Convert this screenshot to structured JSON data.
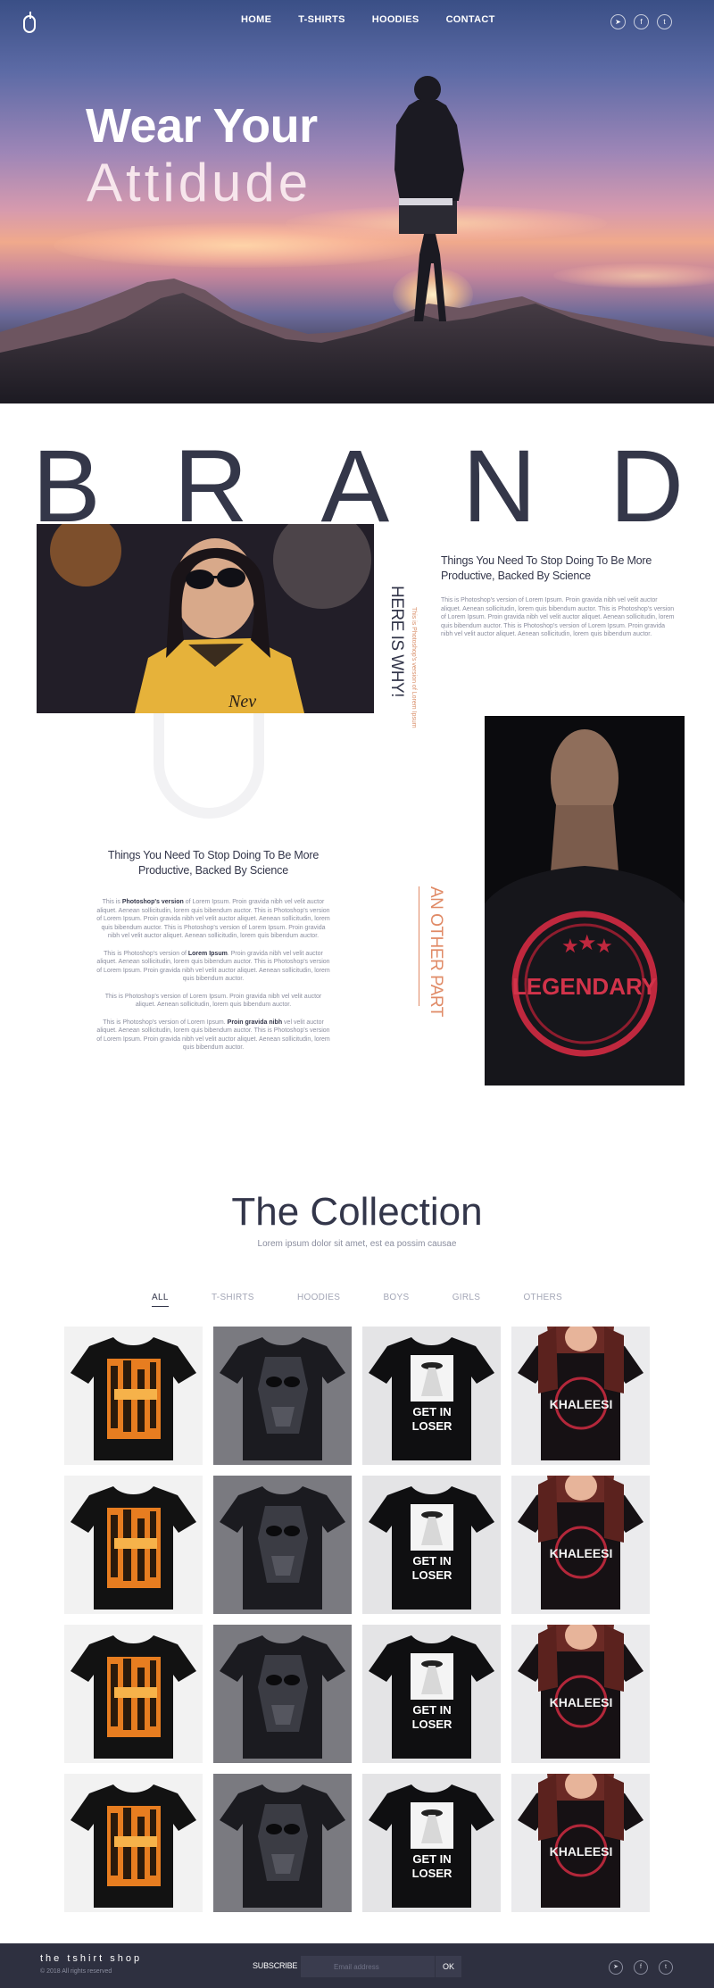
{
  "header": {
    "nav": [
      "HOME",
      "T-SHIRTS",
      "HOODIES",
      "CONTACT"
    ],
    "social_icons": [
      "telegram-icon",
      "facebook-icon",
      "twitter-icon"
    ],
    "social_glyphs": [
      "➤",
      "f",
      "t"
    ]
  },
  "hero": {
    "line1": "Wear Your",
    "line2": "Attidude"
  },
  "brand": {
    "letters": [
      "B",
      "R",
      "A",
      "N",
      "D"
    ],
    "vertical_title": "HERE IS WHY!",
    "vertical_small": "This is Photoshop's version of Lorem Ipsum",
    "block1": {
      "heading_line1": "Things You Need To Stop Doing To Be More",
      "heading_line2": "Productive,  Backed By Science",
      "paragraph": "This is Photoshop's version  of Lorem Ipsum. Proin gravida nibh vel velit auctor aliquet. Aenean sollicitudin, lorem quis bibendum auctor. This is Photoshop's version  of Lorem Ipsum. Proin gravida nibh vel velit auctor aliquet. Aenean sollicitudin, lorem quis bibendum auctor. This is Photoshop's version  of Lorem Ipsum. Proin gravida nibh vel velit auctor aliquet. Aenean sollicitudin, lorem quis bibendum auctor."
    },
    "vertical_other": "AN OTHER PART",
    "shirt_text": "LEGENDARY",
    "block2": {
      "heading_line1": "Things You Need To Stop Doing To Be More",
      "heading_line2": "Productive,  Backed By Science",
      "p1_pre": "This is ",
      "p1_bold": "Photoshop's version",
      "p1_post": "  of Lorem Ipsum. Proin gravida nibh vel velit auctor aliquet. Aenean sollicitudin, lorem quis bibendum auctor.  This is Photoshop's version  of Lorem Ipsum. Proin gravida nibh vel velit auctor aliquet. Aenean sollicitudin, lorem quis bibendum auctor. This is Photoshop's version  of Lorem Ipsum. Proin gravida nibh vel velit auctor aliquet. Aenean sollicitudin, lorem quis bibendum auctor.",
      "p2_pre": "This is Photoshop's version  of ",
      "p2_bold": "Lorem Ipsum",
      "p2_post": ". Proin gravida nibh vel velit auctor aliquet. Aenean sollicitudin, lorem quis bibendum auctor.  This is Photoshop's version  of Lorem Ipsum. Proin gravida nibh vel velit auctor aliquet. Aenean sollicitudin, lorem quis bibendum auctor.",
      "p3": "This is Photoshop's version  of Lorem Ipsum. Proin gravida nibh vel velit auctor aliquet. Aenean sollicitudin, lorem quis bibendum auctor.",
      "p4_pre": "This is Photoshop's version  of Lorem Ipsum. ",
      "p4_bold": "Proin gravida nibh",
      "p4_post": " vel velit auctor aliquet. Aenean sollicitudin, lorem quis bibendum auctor.  This is Photoshop's version  of Lorem Ipsum. Proin gravida nibh vel velit auctor aliquet. Aenean sollicitudin, lorem quis bibendum auctor."
    }
  },
  "collection": {
    "title": "The Collection",
    "subtitle": "Lorem ipsum dolor sit amet, est ea possim causae",
    "tabs": [
      "ALL",
      "T-SHIRTS",
      "HOODIES",
      "BOYS",
      "GIRLS",
      "OTHERS"
    ],
    "active_tab": "ALL",
    "shirt_texts": [
      "GET IN",
      "LOSER",
      "KHALEESI"
    ]
  },
  "footer": {
    "brand": "the tshirt shop",
    "copyright": "© 2018 All rights reserved",
    "subscribe_label": "SUBSCRIBE",
    "email_placeholder": "Email address",
    "ok_label": "OK",
    "social_icons": [
      "telegram-icon",
      "facebook-icon",
      "twitter-icon"
    ]
  }
}
